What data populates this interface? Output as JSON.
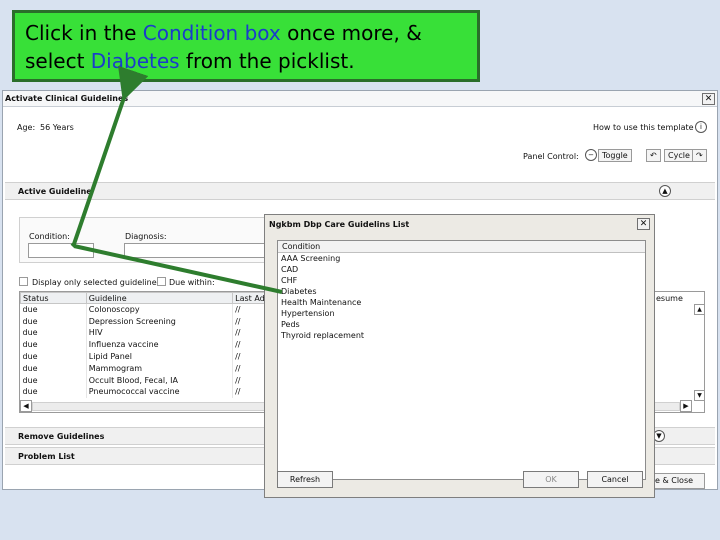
{
  "callout": {
    "line1_a": "Click in the ",
    "line1_b": "Condition box",
    "line1_c": " once more, &",
    "line2_a": "select ",
    "line2_b": "Diabetes",
    "line2_c": " from the picklist."
  },
  "window": {
    "title": "Activate Clinical Guidelines",
    "close": "✕",
    "age_label": "Age:",
    "age_value": "56 Years",
    "howto": "How to use this template",
    "panel_control": "Panel Control:",
    "toggle": "Toggle",
    "cycle": "Cycle",
    "active_guideline": "Active Guideline",
    "condition_label": "Condition:",
    "diagnosis_label": "Diagnosis:",
    "display_only": "Display only selected guideline",
    "due_within": "Due within:",
    "columns": {
      "status": "Status",
      "guideline": "Guideline",
      "last": "Last Ad",
      "resume": "esume"
    },
    "rows": [
      {
        "status": "due",
        "guideline": "Colonoscopy",
        "last": "//"
      },
      {
        "status": "due",
        "guideline": "Depression Screening",
        "last": "//"
      },
      {
        "status": "due",
        "guideline": "HIV",
        "last": "//"
      },
      {
        "status": "due",
        "guideline": "Influenza vaccine",
        "last": "//"
      },
      {
        "status": "due",
        "guideline": "Lipid Panel",
        "last": "//"
      },
      {
        "status": "due",
        "guideline": "Mammogram",
        "last": "//"
      },
      {
        "status": "due",
        "guideline": "Occult Blood, Fecal, IA",
        "last": "//"
      },
      {
        "status": "due",
        "guideline": "Pneumococcal vaccine",
        "last": "//"
      }
    ],
    "remove_guidelines": "Remove Guidelines",
    "problem_list": "Problem List",
    "save_close": "e & Close"
  },
  "picklist": {
    "title": "Ngkbm Dbp Care Guidelins List",
    "close": "✕",
    "header": "Condition",
    "items": [
      "AAA Screening",
      "CAD",
      "CHF",
      "Diabetes",
      "Health Maintenance",
      "Hypertension",
      "Peds",
      "Thyroid replacement"
    ],
    "refresh": "Refresh",
    "ok": "OK",
    "cancel": "Cancel"
  },
  "colors": {
    "callout_bg": "#38e038",
    "arrow": "#2e7d2e",
    "highlight_text": "#1a3ccc"
  }
}
